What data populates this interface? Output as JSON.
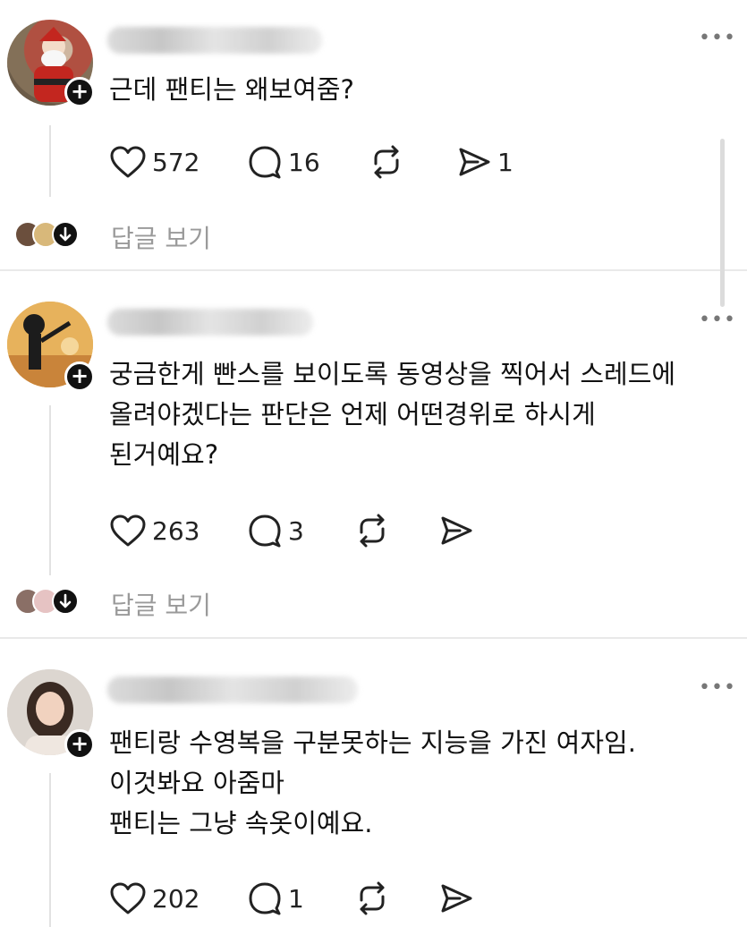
{
  "more_label": "•••",
  "posts": [
    {
      "text_lines": [
        "근데 팬티는 왜보여줌?"
      ],
      "likes": "572",
      "comments": "16",
      "shares": "1",
      "view_replies": "답글 보기"
    },
    {
      "text_lines": [
        "궁금한게 빤스를 보이도록 동영상을 찍어서 스레드에",
        "올려야겠다는 판단은 언제 어떤경위로 하시게",
        "된거예요?"
      ],
      "likes": "263",
      "comments": "3",
      "shares": "",
      "view_replies": "답글 보기"
    },
    {
      "text_lines": [
        "팬티랑 수영복을 구분못하는 지능을 가진 여자임.",
        "이것봐요 아줌마",
        "팬티는 그냥 속옷이예요."
      ],
      "likes": "202",
      "comments": "1",
      "shares": ""
    }
  ],
  "icons": {
    "like": "heart-icon",
    "comment": "comment-bubble-icon",
    "repost": "repost-arrows-icon",
    "share": "send-icon",
    "follow": "plus-icon"
  }
}
